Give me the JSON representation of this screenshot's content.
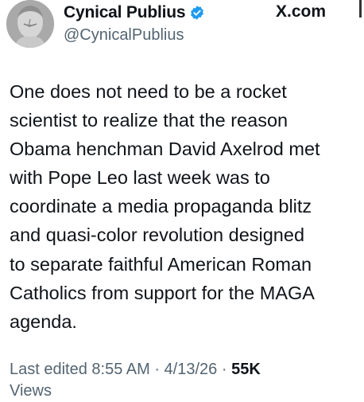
{
  "author": {
    "display_name": "Cynical Publius",
    "handle": "@CynicalPublius"
  },
  "brand": {
    "site": "X.com"
  },
  "tweet": {
    "text": "One does not need to be a rocket\nscientist to realize that  the reason\nObama henchman David Axelrod met\nwith Pope Leo last week was to\ncoordinate a media propaganda blitz\nand quasi-color revolution designed\nto separate faithful American Roman\nCatholics from support for the MAGA\nagenda."
  },
  "meta": {
    "edited_label": "Last edited 8:55 AM · 4/13/26",
    "separator": " · ",
    "views_count": "55K",
    "views_label": "Views"
  },
  "colors": {
    "text": "#0f1419",
    "secondary": "#536471",
    "verified": "#1d9bf0"
  },
  "icons": {
    "avatar": "bust-statue-avatar",
    "verified": "verified-badge-icon",
    "logo": "x-logo-icon"
  }
}
